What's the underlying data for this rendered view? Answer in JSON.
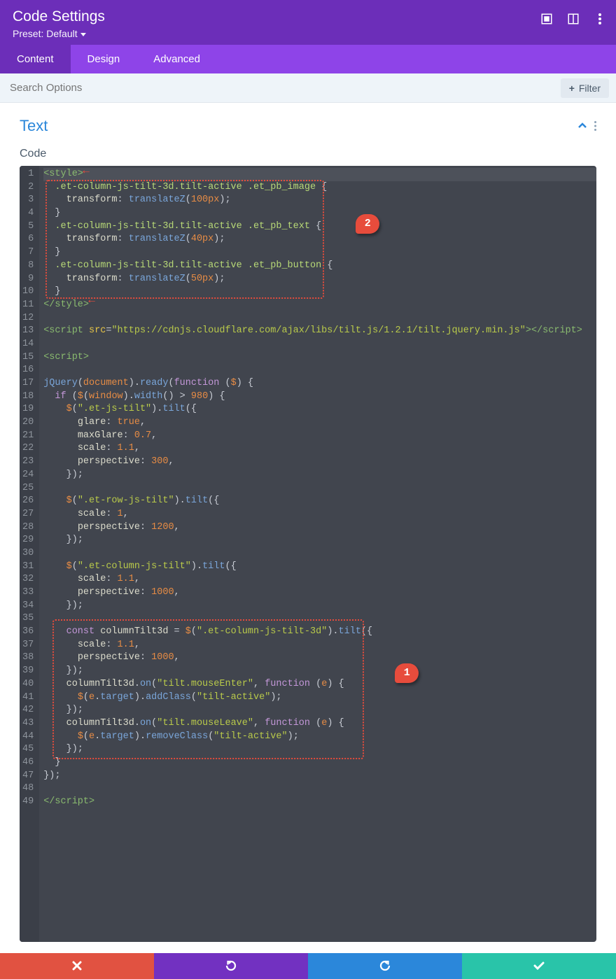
{
  "header": {
    "title": "Code Settings",
    "preset": "Preset: Default"
  },
  "tabs": {
    "content": "Content",
    "design": "Design",
    "advanced": "Advanced",
    "active": "content"
  },
  "search": {
    "placeholder": "Search Options",
    "filter": "Filter"
  },
  "section": {
    "title": "Text",
    "code_label": "Code"
  },
  "callouts": {
    "a": "2",
    "b": "1"
  },
  "code": [
    {
      "n": 1,
      "hl": true,
      "tokens": [
        [
          "t-tag",
          "<style>"
        ]
      ]
    },
    {
      "n": 2,
      "tokens": [
        [
          "",
          "  "
        ],
        [
          "t-sel",
          ".et-column-js-tilt-3d.tilt-active .et_pb_image "
        ],
        [
          "t-pun",
          "{"
        ]
      ]
    },
    {
      "n": 3,
      "tokens": [
        [
          "",
          "    "
        ],
        [
          "t-prop",
          "transform"
        ],
        [
          "t-pun",
          ": "
        ],
        [
          "t-func",
          "translateZ"
        ],
        [
          "t-pun",
          "("
        ],
        [
          "t-num",
          "100px"
        ],
        [
          "t-pun",
          ");"
        ]
      ]
    },
    {
      "n": 4,
      "tokens": [
        [
          "",
          "  "
        ],
        [
          "t-pun",
          "}"
        ]
      ]
    },
    {
      "n": 5,
      "tokens": [
        [
          "",
          "  "
        ],
        [
          "t-sel",
          ".et-column-js-tilt-3d.tilt-active .et_pb_text "
        ],
        [
          "t-pun",
          "{"
        ]
      ]
    },
    {
      "n": 6,
      "tokens": [
        [
          "",
          "    "
        ],
        [
          "t-prop",
          "transform"
        ],
        [
          "t-pun",
          ": "
        ],
        [
          "t-func",
          "translateZ"
        ],
        [
          "t-pun",
          "("
        ],
        [
          "t-num",
          "40px"
        ],
        [
          "t-pun",
          ");"
        ]
      ]
    },
    {
      "n": 7,
      "tokens": [
        [
          "",
          "  "
        ],
        [
          "t-pun",
          "}"
        ]
      ]
    },
    {
      "n": 8,
      "tokens": [
        [
          "",
          "  "
        ],
        [
          "t-sel",
          ".et-column-js-tilt-3d.tilt-active .et_pb_button "
        ],
        [
          "t-pun",
          "{"
        ]
      ]
    },
    {
      "n": 9,
      "tokens": [
        [
          "",
          "    "
        ],
        [
          "t-prop",
          "transform"
        ],
        [
          "t-pun",
          ": "
        ],
        [
          "t-func",
          "translateZ"
        ],
        [
          "t-pun",
          "("
        ],
        [
          "t-num",
          "50px"
        ],
        [
          "t-pun",
          ");"
        ]
      ]
    },
    {
      "n": 10,
      "tokens": [
        [
          "",
          "  "
        ],
        [
          "t-pun",
          "}"
        ]
      ]
    },
    {
      "n": 11,
      "tokens": [
        [
          "t-tag",
          "</style>"
        ]
      ]
    },
    {
      "n": 12,
      "tokens": [
        [
          "",
          ""
        ]
      ]
    },
    {
      "n": 13,
      "tokens": [
        [
          "t-tag",
          "<script "
        ],
        [
          "t-attr",
          "src"
        ],
        [
          "t-pun",
          "="
        ],
        [
          "t-str",
          "\"https://cdnjs.cloudflare.com/ajax/libs/tilt.js/1.2.1/tilt.jquery.min.js\""
        ],
        [
          "t-tag",
          "></script>"
        ]
      ]
    },
    {
      "n": 14,
      "tokens": [
        [
          "",
          ""
        ]
      ]
    },
    {
      "n": 15,
      "tokens": [
        [
          "t-tag",
          "<script>"
        ]
      ]
    },
    {
      "n": 16,
      "tokens": [
        [
          "",
          ""
        ]
      ]
    },
    {
      "n": 17,
      "tokens": [
        [
          "t-name",
          "jQuery"
        ],
        [
          "t-pun",
          "("
        ],
        [
          "t-obj",
          "document"
        ],
        [
          "t-pun",
          "])."
        ],
        [
          "t-m",
          "ready"
        ],
        [
          "t-pun",
          "("
        ],
        [
          "t-kw",
          "function "
        ],
        [
          "t-pun",
          "("
        ],
        [
          "t-obj",
          "$"
        ],
        [
          "t-pun",
          ") {"
        ]
      ]
    },
    {
      "n": 18,
      "tokens": [
        [
          "",
          "  "
        ],
        [
          "t-kw",
          "if "
        ],
        [
          "t-pun",
          "("
        ],
        [
          "t-obj",
          "$"
        ],
        [
          "t-pun",
          "("
        ],
        [
          "t-obj",
          "window"
        ],
        [
          "t-pun",
          "])."
        ],
        [
          "t-m",
          "width"
        ],
        [
          "t-pun",
          "() > "
        ],
        [
          "t-num",
          "980"
        ],
        [
          "t-pun",
          ") {"
        ]
      ]
    },
    {
      "n": 19,
      "tokens": [
        [
          "",
          "    "
        ],
        [
          "t-obj",
          "$"
        ],
        [
          "t-pun",
          "("
        ],
        [
          "t-str",
          "\".et-js-tilt\""
        ],
        [
          "t-pun",
          "])."
        ],
        [
          "t-m",
          "tilt"
        ],
        [
          "t-pun",
          "({"
        ]
      ]
    },
    {
      "n": 20,
      "tokens": [
        [
          "",
          "      "
        ],
        [
          "t-prop",
          "glare"
        ],
        [
          "t-pun",
          ": "
        ],
        [
          "t-true",
          "true"
        ],
        [
          "t-pun",
          ","
        ]
      ]
    },
    {
      "n": 21,
      "tokens": [
        [
          "",
          "      "
        ],
        [
          "t-prop",
          "maxGlare"
        ],
        [
          "t-pun",
          ": "
        ],
        [
          "t-num",
          "0.7"
        ],
        [
          "t-pun",
          ","
        ]
      ]
    },
    {
      "n": 22,
      "tokens": [
        [
          "",
          "      "
        ],
        [
          "t-prop",
          "scale"
        ],
        [
          "t-pun",
          ": "
        ],
        [
          "t-num",
          "1.1"
        ],
        [
          "t-pun",
          ","
        ]
      ]
    },
    {
      "n": 23,
      "tokens": [
        [
          "",
          "      "
        ],
        [
          "t-prop",
          "perspective"
        ],
        [
          "t-pun",
          ": "
        ],
        [
          "t-num",
          "300"
        ],
        [
          "t-pun",
          ","
        ]
      ]
    },
    {
      "n": 24,
      "tokens": [
        [
          "",
          "    "
        ],
        [
          "t-pun",
          "});"
        ]
      ]
    },
    {
      "n": 25,
      "tokens": [
        [
          "",
          ""
        ]
      ]
    },
    {
      "n": 26,
      "tokens": [
        [
          "",
          "    "
        ],
        [
          "t-obj",
          "$"
        ],
        [
          "t-pun",
          "("
        ],
        [
          "t-str",
          "\".et-row-js-tilt\""
        ],
        [
          "t-pun",
          "])."
        ],
        [
          "t-m",
          "tilt"
        ],
        [
          "t-pun",
          "({"
        ]
      ]
    },
    {
      "n": 27,
      "tokens": [
        [
          "",
          "      "
        ],
        [
          "t-prop",
          "scale"
        ],
        [
          "t-pun",
          ": "
        ],
        [
          "t-num",
          "1"
        ],
        [
          "t-pun",
          ","
        ]
      ]
    },
    {
      "n": 28,
      "tokens": [
        [
          "",
          "      "
        ],
        [
          "t-prop",
          "perspective"
        ],
        [
          "t-pun",
          ": "
        ],
        [
          "t-num",
          "1200"
        ],
        [
          "t-pun",
          ","
        ]
      ]
    },
    {
      "n": 29,
      "tokens": [
        [
          "",
          "    "
        ],
        [
          "t-pun",
          "});"
        ]
      ]
    },
    {
      "n": 30,
      "tokens": [
        [
          "",
          ""
        ]
      ]
    },
    {
      "n": 31,
      "tokens": [
        [
          "",
          "    "
        ],
        [
          "t-obj",
          "$"
        ],
        [
          "t-pun",
          "("
        ],
        [
          "t-str",
          "\".et-column-js-tilt\""
        ],
        [
          "t-pun",
          "])."
        ],
        [
          "t-m",
          "tilt"
        ],
        [
          "t-pun",
          "({"
        ]
      ]
    },
    {
      "n": 32,
      "tokens": [
        [
          "",
          "      "
        ],
        [
          "t-prop",
          "scale"
        ],
        [
          "t-pun",
          ": "
        ],
        [
          "t-num",
          "1.1"
        ],
        [
          "t-pun",
          ","
        ]
      ]
    },
    {
      "n": 33,
      "tokens": [
        [
          "",
          "      "
        ],
        [
          "t-prop",
          "perspective"
        ],
        [
          "t-pun",
          ": "
        ],
        [
          "t-num",
          "1000"
        ],
        [
          "t-pun",
          ","
        ]
      ]
    },
    {
      "n": 34,
      "tokens": [
        [
          "",
          "    "
        ],
        [
          "t-pun",
          "});"
        ]
      ]
    },
    {
      "n": 35,
      "tokens": [
        [
          "",
          ""
        ]
      ]
    },
    {
      "n": 36,
      "tokens": [
        [
          "",
          "    "
        ],
        [
          "t-kw",
          "const "
        ],
        [
          "t-prop",
          "columnTilt3d"
        ],
        [
          "t-pun",
          " = "
        ],
        [
          "t-obj",
          "$"
        ],
        [
          "t-pun",
          "("
        ],
        [
          "t-str",
          "\".et-column-js-tilt-3d\""
        ],
        [
          "t-pun",
          "])."
        ],
        [
          "t-m",
          "tilt"
        ],
        [
          "t-pun",
          "({"
        ]
      ]
    },
    {
      "n": 37,
      "tokens": [
        [
          "",
          "      "
        ],
        [
          "t-prop",
          "scale"
        ],
        [
          "t-pun",
          ": "
        ],
        [
          "t-num",
          "1.1"
        ],
        [
          "t-pun",
          ","
        ]
      ]
    },
    {
      "n": 38,
      "tokens": [
        [
          "",
          "      "
        ],
        [
          "t-prop",
          "perspective"
        ],
        [
          "t-pun",
          ": "
        ],
        [
          "t-num",
          "1000"
        ],
        [
          "t-pun",
          ","
        ]
      ]
    },
    {
      "n": 39,
      "tokens": [
        [
          "",
          "    "
        ],
        [
          "t-pun",
          "});"
        ]
      ]
    },
    {
      "n": 40,
      "tokens": [
        [
          "",
          "    "
        ],
        [
          "t-prop",
          "columnTilt3d"
        ],
        [
          "t-pun",
          "."
        ],
        [
          "t-m",
          "on"
        ],
        [
          "t-pun",
          "("
        ],
        [
          "t-str",
          "\"tilt.mouseEnter\""
        ],
        [
          "t-pun",
          ", "
        ],
        [
          "t-kw",
          "function "
        ],
        [
          "t-pun",
          "("
        ],
        [
          "t-obj",
          "e"
        ],
        [
          "t-pun",
          ") {"
        ]
      ]
    },
    {
      "n": 41,
      "tokens": [
        [
          "",
          "      "
        ],
        [
          "t-obj",
          "$"
        ],
        [
          "t-pun",
          "("
        ],
        [
          "t-obj",
          "e"
        ],
        [
          "t-pun",
          "."
        ],
        [
          "t-m",
          "target"
        ],
        [
          "t-pun",
          "])."
        ],
        [
          "t-m",
          "addClass"
        ],
        [
          "t-pun",
          "("
        ],
        [
          "t-str",
          "\"tilt-active\""
        ],
        [
          "t-pun",
          ");"
        ]
      ]
    },
    {
      "n": 42,
      "tokens": [
        [
          "",
          "    "
        ],
        [
          "t-pun",
          "});"
        ]
      ]
    },
    {
      "n": 43,
      "tokens": [
        [
          "",
          "    "
        ],
        [
          "t-prop",
          "columnTilt3d"
        ],
        [
          "t-pun",
          "."
        ],
        [
          "t-m",
          "on"
        ],
        [
          "t-pun",
          "("
        ],
        [
          "t-str",
          "\"tilt.mouseLeave\""
        ],
        [
          "t-pun",
          ", "
        ],
        [
          "t-kw",
          "function "
        ],
        [
          "t-pun",
          "("
        ],
        [
          "t-obj",
          "e"
        ],
        [
          "t-pun",
          ") {"
        ]
      ]
    },
    {
      "n": 44,
      "tokens": [
        [
          "",
          "      "
        ],
        [
          "t-obj",
          "$"
        ],
        [
          "t-pun",
          "("
        ],
        [
          "t-obj",
          "e"
        ],
        [
          "t-pun",
          "."
        ],
        [
          "t-m",
          "target"
        ],
        [
          "t-pun",
          "])."
        ],
        [
          "t-m",
          "removeClass"
        ],
        [
          "t-pun",
          "("
        ],
        [
          "t-str",
          "\"tilt-active\""
        ],
        [
          "t-pun",
          ");"
        ]
      ]
    },
    {
      "n": 45,
      "tokens": [
        [
          "",
          "    "
        ],
        [
          "t-pun",
          "});"
        ]
      ]
    },
    {
      "n": 46,
      "tokens": [
        [
          "",
          "  "
        ],
        [
          "t-pun",
          "}"
        ]
      ]
    },
    {
      "n": 47,
      "tokens": [
        [
          "t-pun",
          "});"
        ]
      ]
    },
    {
      "n": 48,
      "tokens": [
        [
          "",
          ""
        ]
      ]
    },
    {
      "n": 49,
      "tokens": [
        [
          "t-tag",
          "</script>"
        ]
      ]
    }
  ]
}
